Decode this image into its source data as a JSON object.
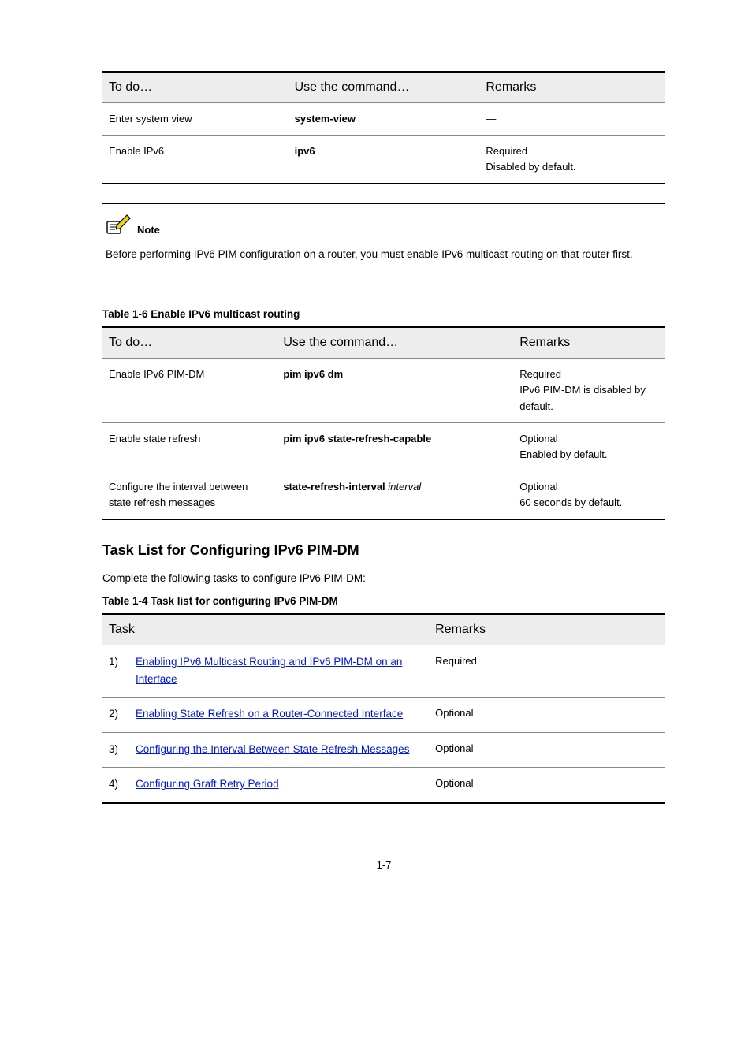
{
  "table1": {
    "headers": [
      "To do…",
      "Use the command…",
      "Remarks"
    ],
    "rows": [
      [
        "Enter system view",
        "system-view",
        "—"
      ],
      [
        "Enable IPv6",
        "ipv6",
        "Required\nDisabled by default."
      ]
    ]
  },
  "note": {
    "label": "Note",
    "text": "Before performing IPv6 PIM configuration on a router, you must enable IPv6 multicast routing on that router first."
  },
  "table2": {
    "caption": "Table 1-6 Enable IPv6 multicast routing",
    "headers": [
      "To do…",
      "Use the command…",
      "Remarks"
    ],
    "rows": [
      [
        "Enable IPv6 PIM-DM",
        "pim ipv6 dm",
        "Required\nIPv6 PIM-DM is disabled by default."
      ],
      [
        "Enable state refresh",
        "pim ipv6 state-refresh-capable",
        "Optional\nEnabled by default."
      ],
      [
        "Configure the interval between state refresh messages",
        "state-refresh-interval interval",
        "Optional\n60 seconds by default."
      ]
    ]
  },
  "section": {
    "title": "Task List for Configuring IPv6 PIM-DM",
    "intro": "Complete the following tasks to configure IPv6 PIM-DM:",
    "tableCaption": "Table 1-4 Task list for configuring IPv6 PIM-DM"
  },
  "table3": {
    "headers": [
      "Task",
      "Remarks"
    ],
    "rows": [
      [
        {
          "text": "Enabling IPv6 Multicast Routing and IPv6 PIM-DM on an Interface",
          "link": true
        },
        "Required"
      ],
      [
        {
          "text": "Enabling State Refresh on a Router-Connected Interface",
          "link": true
        },
        "Optional"
      ],
      [
        {
          "text": "Configuring the Interval Between State Refresh Messages",
          "link": true
        },
        "Optional"
      ],
      [
        {
          "text": "Configuring Graft Retry Period",
          "link": true
        },
        "Optional"
      ]
    ]
  },
  "footer": "1-7"
}
